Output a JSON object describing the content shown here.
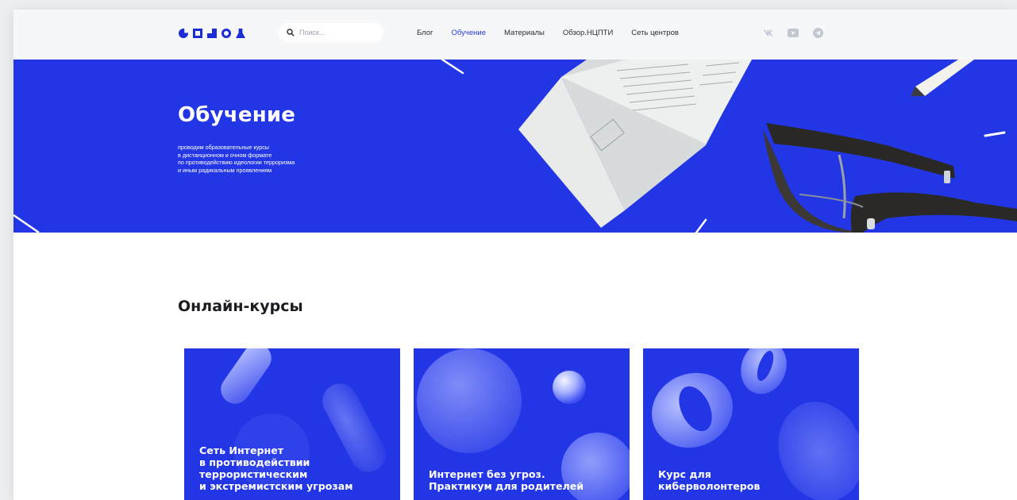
{
  "header": {
    "search_placeholder": "Поиск...",
    "nav": [
      {
        "label": "Блог",
        "active": false
      },
      {
        "label": "Обучение",
        "active": true
      },
      {
        "label": "Материалы",
        "active": false
      },
      {
        "label": "Обзор.НЦПТИ",
        "active": false
      },
      {
        "label": "Сеть центров",
        "active": false
      }
    ],
    "social": [
      "vk-icon",
      "youtube-icon",
      "telegram-icon"
    ]
  },
  "hero": {
    "title": "Обучение",
    "description": [
      "проводим образовательные курсы",
      "в дистанционном и очном формате",
      "по противодействию идеологии терроризма",
      "и иным радикальным проявлениям"
    ]
  },
  "section": {
    "title": "Онлайн-курсы"
  },
  "courses": [
    {
      "lines": [
        "Сеть Интернет",
        "в противодействии",
        "террористическим",
        "и экстремистским угрозам"
      ]
    },
    {
      "lines": [
        "Интернет без угроз.",
        "Практикум для родителей"
      ]
    },
    {
      "lines": [
        "Курс для",
        "кибер­волонтеров"
      ]
    }
  ],
  "colors": {
    "brand_blue": "#2336e6",
    "nav_active": "#2a3be0",
    "header_bg": "#f6f7f9"
  }
}
